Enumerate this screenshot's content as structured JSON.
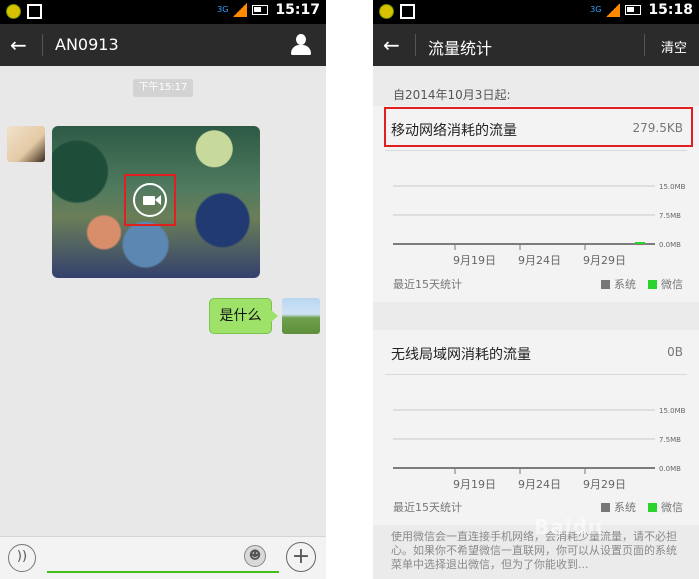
{
  "left_screen": {
    "status": {
      "time": "15:17",
      "net": "3G"
    },
    "header": {
      "title": "AN0913"
    },
    "timestamp": "下午15:17",
    "outgoing_text": "是什么"
  },
  "right_screen": {
    "status": {
      "time": "15:18",
      "net": "3G"
    },
    "header": {
      "title": "流量统计",
      "clear_label": "清空"
    },
    "since_label": "自2014年10月3日起:",
    "mobile": {
      "title": "移动网络消耗的流量",
      "value": "279.5KB",
      "footer": "最近15天统计"
    },
    "wifi": {
      "title": "无线局域网消耗的流量",
      "value": "0B",
      "footer": "最近15天统计"
    },
    "legend": {
      "system": "系统",
      "wechat": "微信"
    },
    "info_text": "使用微信会一直连接手机网络，会消耗少量流量，请不必担心。如果你不希望微信一直联网，你可以从设置页面的系统菜单中选择退出微信，但为了你能收到..."
  },
  "chart_data": [
    {
      "type": "bar",
      "title": "移动网络消耗的流量",
      "x_tick_labels": [
        "9月19日",
        "9月24日",
        "9月29日"
      ],
      "y_tick_labels": [
        "15.0MB",
        "7.5MB",
        "0.0MB"
      ],
      "ylim": [
        0,
        15.0
      ],
      "series": [
        {
          "name": "系统",
          "values": [
            0,
            0,
            0
          ]
        },
        {
          "name": "微信",
          "values": [
            0,
            0,
            0.28
          ]
        }
      ],
      "legend": "bottom-right"
    },
    {
      "type": "bar",
      "title": "无线局域网消耗的流量",
      "x_tick_labels": [
        "9月19日",
        "9月24日",
        "9月29日"
      ],
      "y_tick_labels": [
        "15.0MB",
        "7.5MB",
        "0.0MB"
      ],
      "ylim": [
        0,
        15.0
      ],
      "series": [
        {
          "name": "系统",
          "values": [
            0,
            0,
            0
          ]
        },
        {
          "name": "微信",
          "values": [
            0,
            0,
            0
          ]
        }
      ],
      "legend": "bottom-right"
    }
  ],
  "colors": {
    "accent_green": "#45c01a",
    "bubble_green": "#9ee26a",
    "highlight_red": "#e02020",
    "header_dark": "#2b2b2b"
  }
}
